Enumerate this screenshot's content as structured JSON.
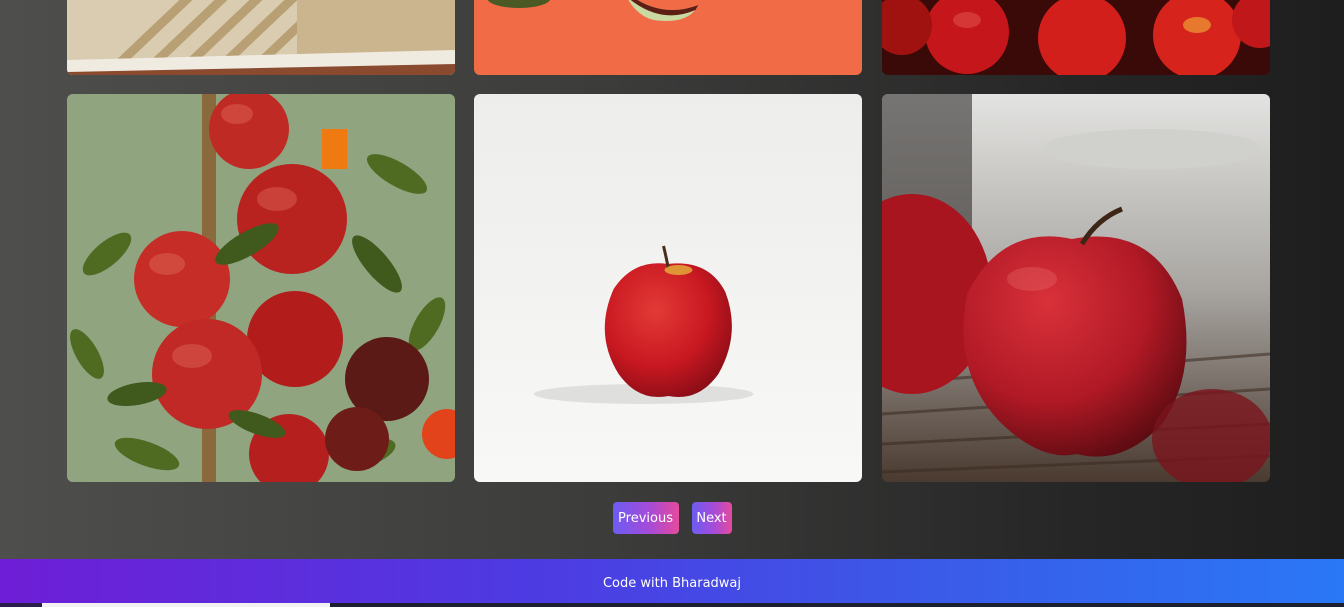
{
  "gallery": {
    "top_row": [
      {
        "name": "striped-tablecloth-photo"
      },
      {
        "name": "apple-slices-orange-photo"
      },
      {
        "name": "apples-pile-photo"
      }
    ],
    "main_row": [
      {
        "name": "apples-on-tree-photo"
      },
      {
        "name": "single-apple-white-photo"
      },
      {
        "name": "apple-on-table-photo"
      }
    ]
  },
  "pagination": {
    "previous_label": "Previous",
    "next_label": "Next"
  },
  "footer": {
    "text": "Code with Bharadwaj"
  },
  "colors": {
    "button_gradient_start": "#6c5cf2",
    "button_gradient_end": "#e64a9c",
    "footer_gradient_start": "#6e1ed6",
    "footer_gradient_end": "#2a78f5",
    "orange_card": "#f26b47"
  }
}
